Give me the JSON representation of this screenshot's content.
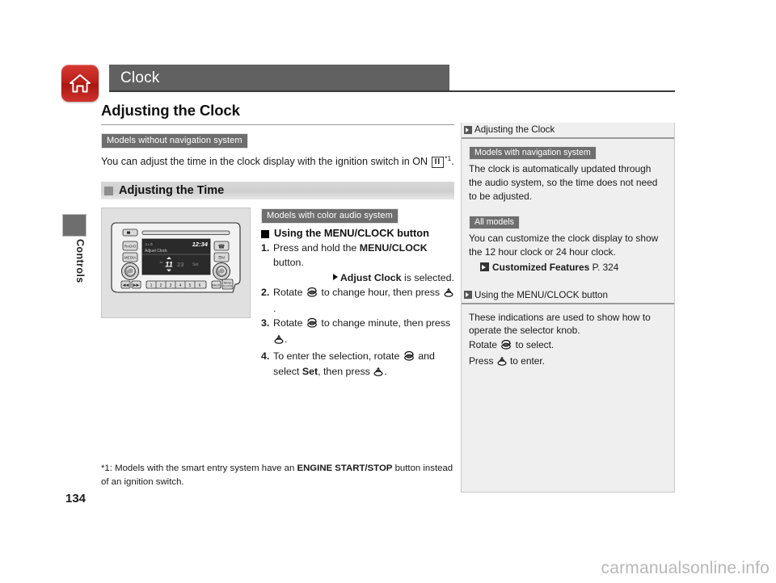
{
  "chapter": {
    "title": "Clock",
    "home_icon": "home-icon",
    "side_tab_label": "Controls",
    "page_number": "134"
  },
  "main": {
    "section_title": "Adjusting the Clock",
    "badge_without_nav": "Models without navigation system",
    "intro_before": "You can adjust the time in the clock display with the ignition switch in ON ",
    "ignition_glyph": "II",
    "intro_footnote_mark": "*1",
    "intro_after": ".",
    "subsection_title": "Adjusting the Time",
    "badge_color_audio": "Models with color audio system",
    "steps_heading": "Using the MENU/CLOCK button",
    "steps": [
      {
        "num": "1.",
        "pre": "Press and hold the ",
        "bold": "MENU/CLOCK",
        "post": " button."
      },
      {
        "num": "2.",
        "pre": "Rotate ",
        "mid": " to change hour, then press ",
        "post": "."
      },
      {
        "num": "3.",
        "pre": "Rotate ",
        "mid": " to change minute, then press ",
        "post": "."
      },
      {
        "num": "4.",
        "pre": "To enter the selection, rotate ",
        "mid": " and select ",
        "bold": "Set",
        "post": ", then press ",
        "end": "."
      }
    ],
    "step1_note_bold": "Adjust Clock",
    "step1_note_rest": " is selected.",
    "footnote": {
      "pre": "*1: Models with the smart entry system have an ",
      "bold": "ENGINE START/STOP",
      "post": " button instead of an ignition switch."
    }
  },
  "illustration": {
    "name": "color-audio-head-unit",
    "display_time": "12:34",
    "display_label": "Adjust Clock",
    "display_hour": "11",
    "display_minute": "23",
    "display_set": "Set",
    "side_buttons_left": [
      "RADIO",
      "MEDIA"
    ],
    "preset_buttons": [
      "1",
      "2",
      "3",
      "4",
      "5",
      "6"
    ],
    "skip_buttons": [
      "◀◀",
      "▶▶"
    ],
    "right_lower_buttons": [
      "BACK",
      "MENU/\nCLOCK"
    ]
  },
  "sidebar": {
    "section1": {
      "heading": "Adjusting the Clock",
      "badge_nav": "Models with navigation system",
      "text_nav": "The clock is automatically updated through the audio system, so the time does not need to be adjusted.",
      "badge_all": "All models",
      "text_all": "You can customize the clock display to show the 12 hour clock or 24 hour clock.",
      "ref_bold": "Customized Features",
      "ref_page": " P. 324"
    },
    "section2": {
      "heading": "Using the MENU/CLOCK button",
      "line1": "These indications are used to show how to operate the selector knob.",
      "rotate_pre": "Rotate ",
      "rotate_post": " to select.",
      "press_pre": "Press ",
      "press_post": " to enter."
    }
  },
  "watermark": "carmanualsonline.info",
  "colors": {
    "chapter_bar": "#616161",
    "home_red": "#bb1f1a",
    "badge_gray": "#6e6e6e",
    "sidebar_bg": "#efefef",
    "illus_bg": "#e0e0e0"
  }
}
